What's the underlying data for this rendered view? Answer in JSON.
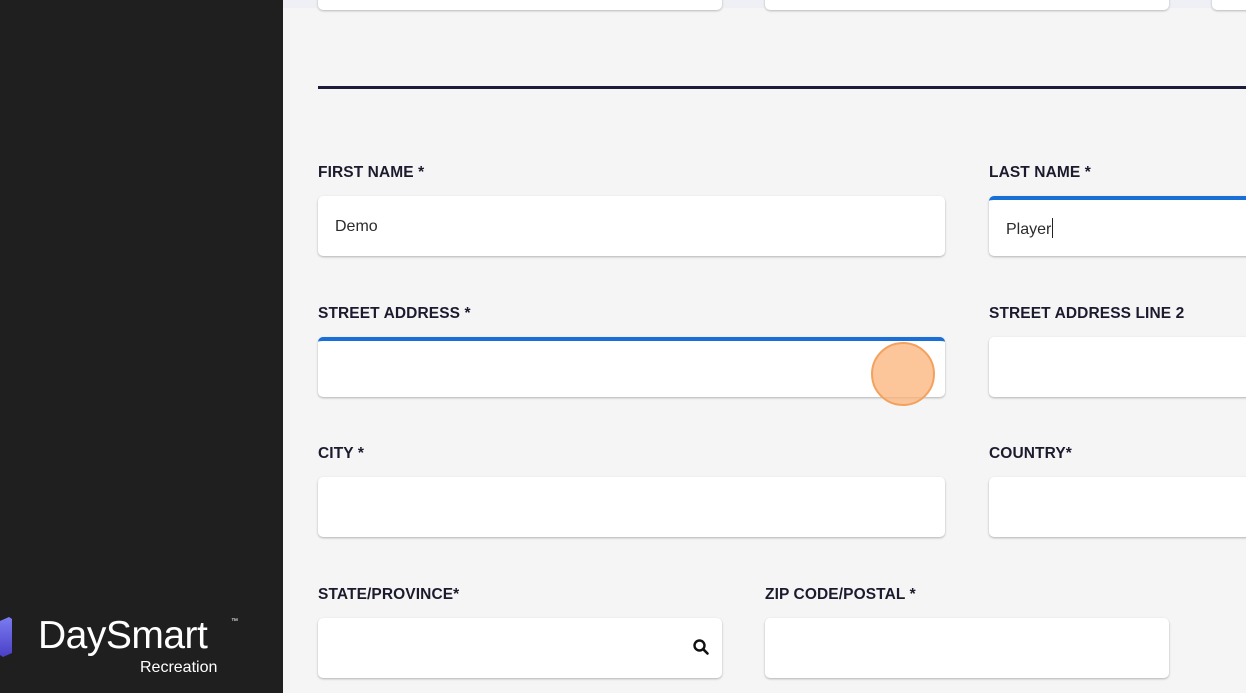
{
  "brand": {
    "name": "DaySmart",
    "trademark": "™",
    "subtitle": "Recreation"
  },
  "form": {
    "first_name": {
      "label": "FIRST NAME *",
      "value": "Demo"
    },
    "last_name": {
      "label": "LAST NAME *",
      "value": "Player"
    },
    "street_address": {
      "label": "STREET ADDRESS *",
      "value": ""
    },
    "street_address_2": {
      "label": "STREET ADDRESS LINE 2",
      "value": ""
    },
    "city": {
      "label": "CITY *",
      "value": ""
    },
    "country": {
      "label": "COUNTRY*",
      "value": ""
    },
    "state_province": {
      "label": "STATE/PROVINCE*",
      "value": ""
    },
    "zip_code": {
      "label": "ZIP CODE/POSTAL *",
      "value": ""
    }
  },
  "colors": {
    "focus_accent": "#1a6fd6",
    "sidebar": "#1f1f1f",
    "click_marker": "#fbb278"
  },
  "icons": {
    "state_search": "search-icon",
    "logo": "daysmart-logo-mark"
  }
}
